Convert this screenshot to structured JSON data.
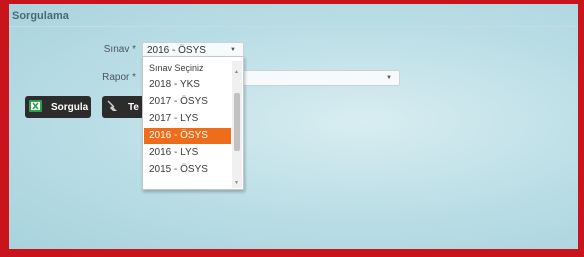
{
  "panel": {
    "title": "Sorgulama"
  },
  "form": {
    "sinav_label": "Sınav *",
    "sinav_value": "2016 - ÖSYS",
    "rapor_label": "Rapor *",
    "rapor_value": ""
  },
  "buttons": {
    "sorgula": "Sorgula",
    "temizle": "Te"
  },
  "dropdown": {
    "options": [
      "Sınav Seçiniz",
      "2018 - YKS",
      "2017 - ÖSYS",
      "2017 - LYS",
      "2016 - ÖSYS",
      "2016 - LYS",
      "2015 - ÖSYS"
    ],
    "selected": "2016 - ÖSYS"
  },
  "colors": {
    "frame": "#c8141a",
    "highlight": "#ee6d1a",
    "button": "#2c2c2c"
  },
  "icons": [
    "excel-icon",
    "broom-icon",
    "chevron-down-icon",
    "scroll-up-icon",
    "scroll-down-icon"
  ]
}
